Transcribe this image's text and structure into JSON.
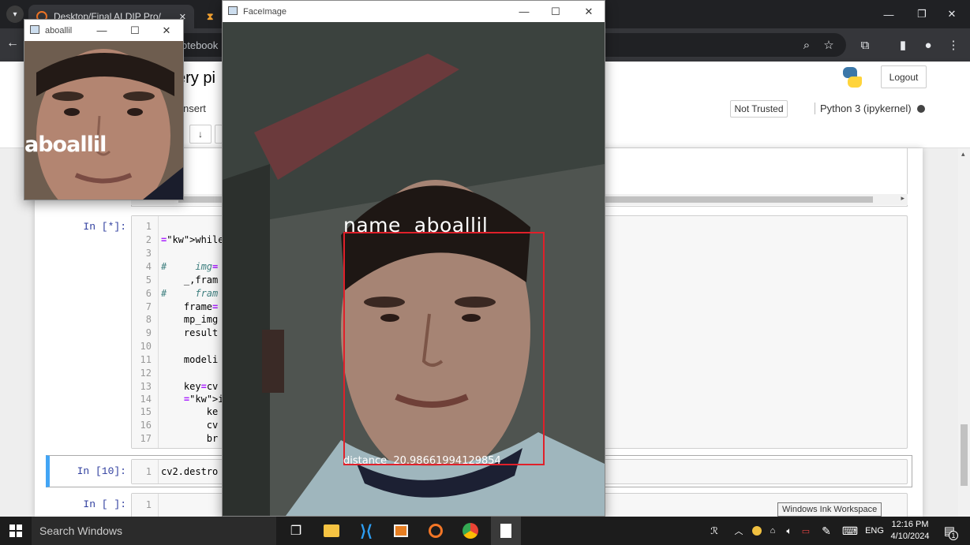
{
  "browser": {
    "tabs": [
      {
        "title": "Desktop/Final AI DIP Pro/",
        "close": "✕"
      },
      {
        "title": "",
        "close": ""
      }
    ],
    "window_controls": {
      "minimize": "—",
      "restore": "❐",
      "close": "✕"
    },
    "address_partial": "otebook"
  },
  "jupyter": {
    "title_partial": "ery pi",
    "menu_partial": "nsert",
    "move_down_button": "↓",
    "not_trusted": "Not Trusted",
    "kernel": "Python 3 (ipykernel)",
    "logout": "Logout"
  },
  "cells": [
    {
      "prompt": "In [*]:",
      "lines": [
        {
          "n": "1",
          "code": ""
        },
        {
          "n": "2",
          "code": "while Stre"
        },
        {
          "n": "3",
          "code": ""
        },
        {
          "n": "4",
          "code": "#     img="
        },
        {
          "n": "5",
          "code": "    _,fram"
        },
        {
          "n": "6",
          "code": "#     fram"
        },
        {
          "n": "7",
          "code": "    frame="
        },
        {
          "n": "8",
          "code": "    mp_img"
        },
        {
          "n": "9",
          "code": "    result"
        },
        {
          "n": "10",
          "code": ""
        },
        {
          "n": "11",
          "code": "    modeli"
        },
        {
          "n": "12",
          "code": ""
        },
        {
          "n": "13",
          "code": "    key=cv"
        },
        {
          "n": "14",
          "code": "    if key"
        },
        {
          "n": "15",
          "code": "        ke"
        },
        {
          "n": "16",
          "code": "        cv"
        },
        {
          "n": "17",
          "code": "        br"
        }
      ]
    },
    {
      "prompt": "In [10]:",
      "lines": [
        {
          "n": "1",
          "code": "cv2.destro"
        }
      ]
    },
    {
      "prompt": "In [ ]:",
      "lines": [
        {
          "n": "1",
          "code": ""
        }
      ]
    }
  ],
  "small_window": {
    "title": "aboallil",
    "overlay_text": "aboallil",
    "controls": {
      "minimize": "—",
      "maximize": "☐",
      "close": "✕"
    }
  },
  "face_window": {
    "title": "FaceImage",
    "name_label": "name  aboallil",
    "distance_label": "distance  20.98661994129854",
    "box_color": "#e0202a",
    "controls": {
      "minimize": "—",
      "maximize": "☐",
      "close": "✕"
    }
  },
  "tooltip": "Windows Ink Workspace",
  "taskbar": {
    "search_placeholder": "Search Windows",
    "language": "ENG",
    "time": "12:16 PM",
    "date": "4/10/2024",
    "notification_count": "1"
  }
}
